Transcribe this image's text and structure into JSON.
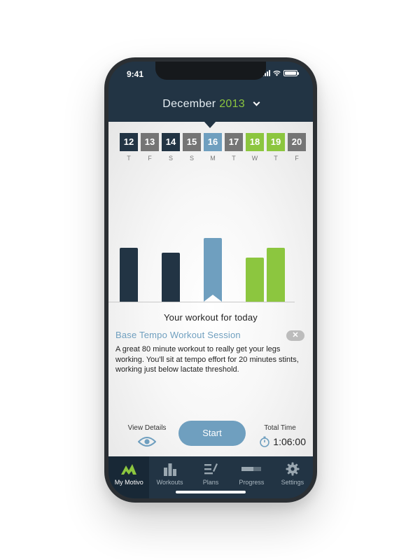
{
  "status_bar": {
    "time": "9:41"
  },
  "header": {
    "month": "December",
    "year": "2013"
  },
  "calendar": {
    "days": [
      {
        "date": "12",
        "weekday": "T",
        "color": "navy"
      },
      {
        "date": "13",
        "weekday": "F",
        "color": "gray"
      },
      {
        "date": "14",
        "weekday": "S",
        "color": "navy"
      },
      {
        "date": "15",
        "weekday": "S",
        "color": "gray"
      },
      {
        "date": "16",
        "weekday": "M",
        "color": "blue"
      },
      {
        "date": "17",
        "weekday": "T",
        "color": "gray"
      },
      {
        "date": "18",
        "weekday": "W",
        "color": "green"
      },
      {
        "date": "19",
        "weekday": "T",
        "color": "green"
      },
      {
        "date": "20",
        "weekday": "F",
        "color": "gray"
      }
    ]
  },
  "workout": {
    "section_title": "Your workout for today",
    "session_title": "Base Tempo Workout Session",
    "close_label": "✕",
    "description": "A great 80 minute workout to really get your legs working. You'll sit at tempo effort for 20 minutes stints, working just below lactate threshold."
  },
  "actions": {
    "view_details_label": "View Details",
    "start_label": "Start",
    "total_time_label": "Total Time",
    "total_time_value": "1:06:00"
  },
  "tabs": [
    {
      "label": "My Motivo",
      "icon": "motivo-logo-icon",
      "active": true
    },
    {
      "label": "Workouts",
      "icon": "bar-chart-icon",
      "active": false
    },
    {
      "label": "Plans",
      "icon": "plans-icon",
      "active": false
    },
    {
      "label": "Progress",
      "icon": "progress-icon",
      "active": false
    },
    {
      "label": "Settings",
      "icon": "gear-icon",
      "active": false
    }
  ],
  "colors": {
    "navy": "#223444",
    "blue": "#6f9fbf",
    "green": "#8cc63f",
    "gray": "#757575"
  }
}
